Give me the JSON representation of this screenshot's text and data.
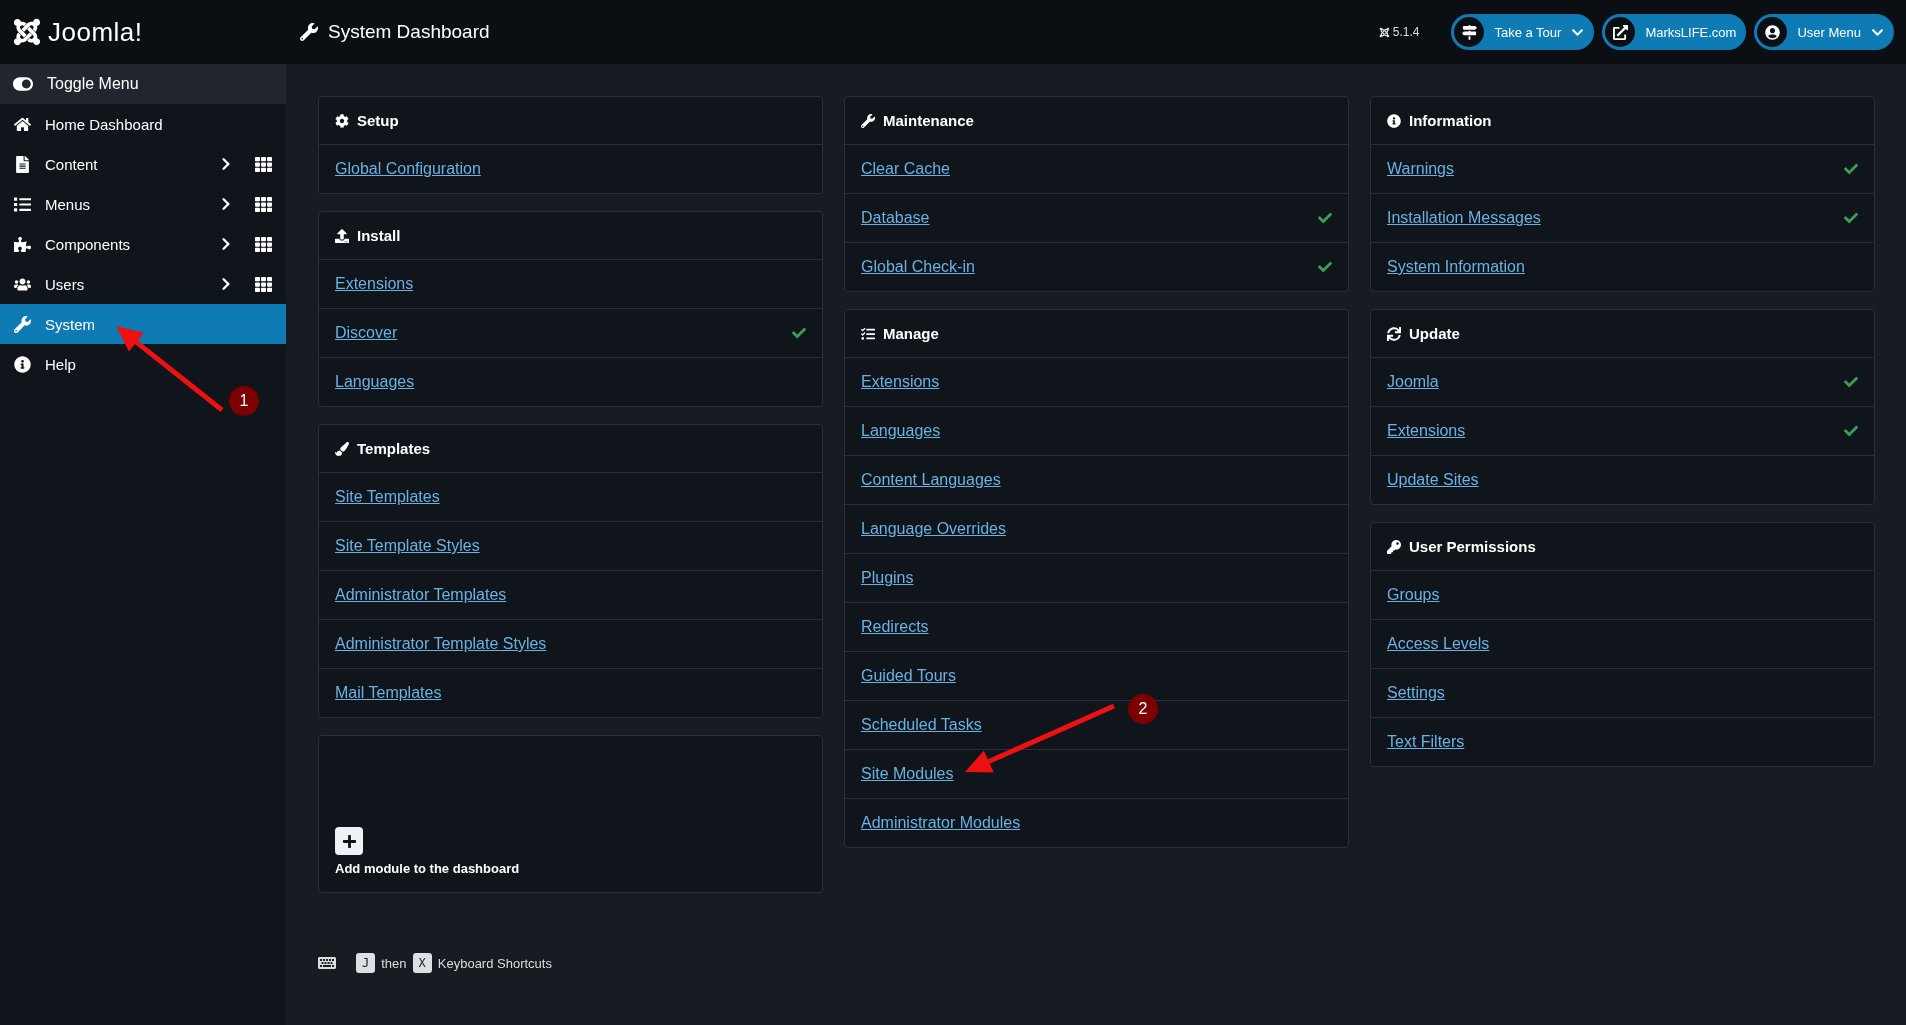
{
  "header": {
    "logo": "Joomla!",
    "title": "System Dashboard",
    "version": "5.1.4",
    "buttons": [
      {
        "label": "Take a Tour",
        "dropdown": true
      },
      {
        "label": "MarksLIFE.com",
        "dropdown": false
      },
      {
        "label": "User Menu",
        "dropdown": true
      }
    ]
  },
  "sidebar": {
    "toggle": "Toggle Menu",
    "items": [
      {
        "label": "Home Dashboard",
        "kind": "link",
        "selected": false
      },
      {
        "label": "Content",
        "kind": "group",
        "selected": false
      },
      {
        "label": "Menus",
        "kind": "group",
        "selected": false
      },
      {
        "label": "Components",
        "kind": "group",
        "selected": false
      },
      {
        "label": "Users",
        "kind": "group",
        "selected": false
      },
      {
        "label": "System",
        "kind": "link",
        "selected": true
      },
      {
        "label": "Help",
        "kind": "link",
        "selected": false
      }
    ]
  },
  "columns": [
    [
      {
        "kind": "links",
        "title": "Setup",
        "links": [
          {
            "label": "Global Configuration",
            "checked": false
          }
        ]
      },
      {
        "kind": "links",
        "title": "Install",
        "links": [
          {
            "label": "Extensions",
            "checked": false
          },
          {
            "label": "Discover",
            "checked": true
          },
          {
            "label": "Languages",
            "checked": false
          }
        ]
      },
      {
        "kind": "links",
        "title": "Templates",
        "links": [
          {
            "label": "Site Templates",
            "checked": false
          },
          {
            "label": "Site Template Styles",
            "checked": false
          },
          {
            "label": "Administrator Templates",
            "checked": false
          },
          {
            "label": "Administrator Template Styles",
            "checked": false
          },
          {
            "label": "Mail Templates",
            "checked": false
          }
        ]
      },
      {
        "kind": "add",
        "title": "Add module to the dashboard"
      }
    ],
    [
      {
        "kind": "links",
        "title": "Maintenance",
        "links": [
          {
            "label": "Clear Cache",
            "checked": false
          },
          {
            "label": "Database",
            "checked": true
          },
          {
            "label": "Global Check-in",
            "checked": true
          }
        ]
      },
      {
        "kind": "links",
        "title": "Manage",
        "links": [
          {
            "label": "Extensions",
            "checked": false
          },
          {
            "label": "Languages",
            "checked": false
          },
          {
            "label": "Content Languages",
            "checked": false
          },
          {
            "label": "Language Overrides",
            "checked": false
          },
          {
            "label": "Plugins",
            "checked": false
          },
          {
            "label": "Redirects",
            "checked": false
          },
          {
            "label": "Guided Tours",
            "checked": false
          },
          {
            "label": "Scheduled Tasks",
            "checked": false
          },
          {
            "label": "Site Modules",
            "checked": false
          },
          {
            "label": "Administrator Modules",
            "checked": false
          }
        ]
      }
    ],
    [
      {
        "kind": "links",
        "title": "Information",
        "links": [
          {
            "label": "Warnings",
            "checked": true
          },
          {
            "label": "Installation Messages",
            "checked": true
          },
          {
            "label": "System Information",
            "checked": false
          }
        ]
      },
      {
        "kind": "links",
        "title": "Update",
        "links": [
          {
            "label": "Joomla",
            "checked": true
          },
          {
            "label": "Extensions",
            "checked": true
          },
          {
            "label": "Update Sites",
            "checked": false
          }
        ]
      },
      {
        "kind": "links",
        "title": "User Permissions",
        "links": [
          {
            "label": "Groups",
            "checked": false
          },
          {
            "label": "Access Levels",
            "checked": false
          },
          {
            "label": "Settings",
            "checked": false
          },
          {
            "label": "Text Filters",
            "checked": false
          }
        ]
      }
    ]
  ],
  "shortcuts": {
    "key_1": "J",
    "joiner": "then",
    "key_2": "X",
    "label": "Keyboard Shortcuts"
  },
  "annotations": [
    {
      "number": "1"
    },
    {
      "number": "2"
    }
  ]
}
